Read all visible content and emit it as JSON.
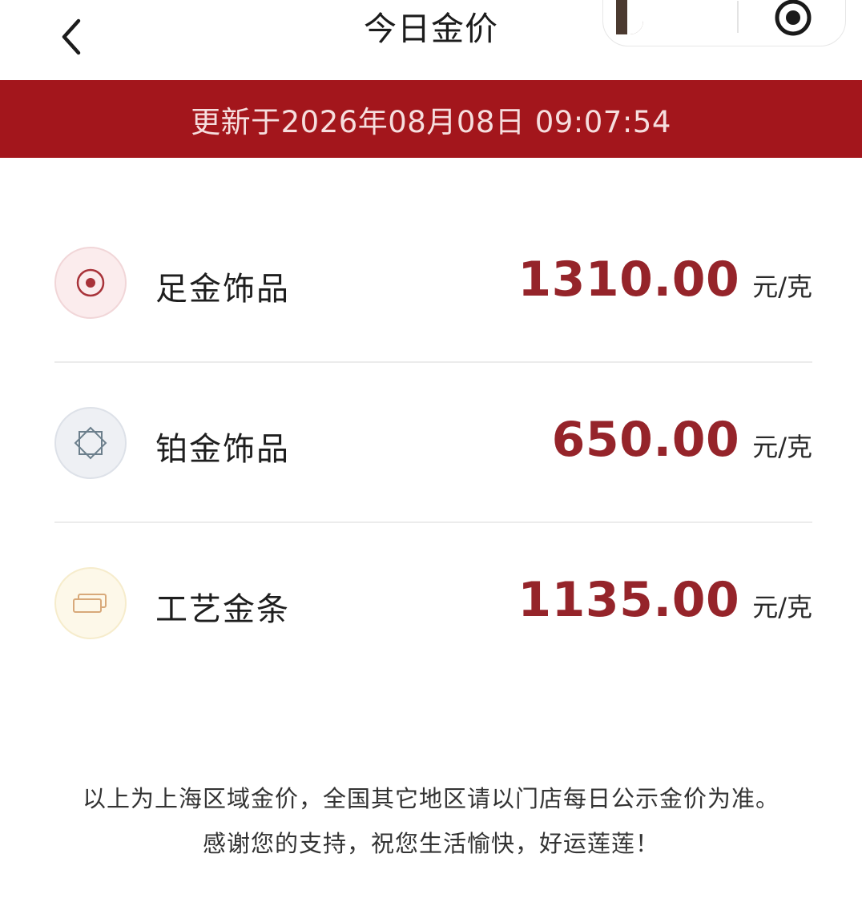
{
  "header": {
    "title": "今日金价",
    "back_icon": "chevron-left-icon",
    "capsule": {
      "avatar": "avatar",
      "close_icon": "target-icon"
    }
  },
  "banner": {
    "text": "更新于2026年08月08日 09:07:54",
    "color": "#a3161c"
  },
  "prices": [
    {
      "icon": "gold-ring-icon",
      "name": "足金饰品",
      "price": "1310.00",
      "unit": "元/克"
    },
    {
      "icon": "platinum-diamond-icon",
      "name": "铂金饰品",
      "price": "650.00",
      "unit": "元/克"
    },
    {
      "icon": "gold-bar-icon",
      "name": "工艺金条",
      "price": "1135.00",
      "unit": "元/克"
    }
  ],
  "footer": {
    "line1": "以上为上海区域金价，全国其它地区请以门店每日公示金价为准。",
    "line2": "感谢您的支持，祝您生活愉快，好运莲莲！"
  },
  "colors": {
    "accent": "#95242a",
    "banner": "#a3161c"
  }
}
